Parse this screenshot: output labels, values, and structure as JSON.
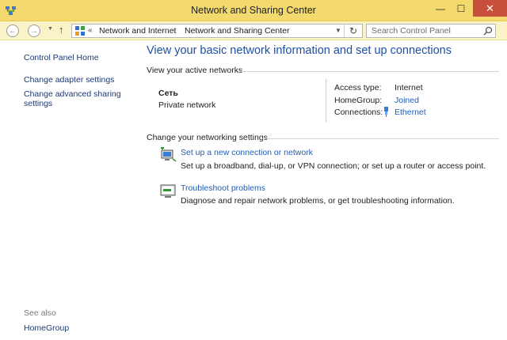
{
  "window": {
    "title": "Network and Sharing Center",
    "minimize_glyph": "—",
    "maximize_glyph": "☐",
    "close_glyph": "✕"
  },
  "nav": {
    "back_glyph": "←",
    "forward_glyph": "→",
    "dropdown_glyph": "▼",
    "up_glyph": "↑",
    "overflow_glyph": "«",
    "breadcrumb": [
      "Network and Internet",
      "Network and Sharing Center"
    ],
    "separator_glyph": "›",
    "refresh_glyph": "↻",
    "search_placeholder": "Search Control Panel"
  },
  "sidebar": {
    "home": "Control Panel Home",
    "links": [
      "Change adapter settings",
      "Change advanced sharing settings"
    ],
    "see_also_label": "See also",
    "see_also_links": [
      "HomeGroup"
    ]
  },
  "main": {
    "title": "View your basic network information and set up connections",
    "active_networks": {
      "header": "View your active networks",
      "network_name": "Сеть",
      "network_type": "Private network",
      "access_type_label": "Access type:",
      "access_type_value": "Internet",
      "homegroup_label": "HomeGroup:",
      "homegroup_value": "Joined",
      "connections_label": "Connections:",
      "connections_value": "Ethernet"
    },
    "change_settings": {
      "header": "Change your networking settings",
      "tasks": [
        {
          "title": "Set up a new connection or network",
          "description": "Set up a broadband, dial-up, or VPN connection; or set up a router or access point.",
          "icon": "new-connection-icon"
        },
        {
          "title": "Troubleshoot problems",
          "description": "Diagnose and repair network problems, or get troubleshooting information.",
          "icon": "troubleshoot-icon"
        }
      ]
    }
  },
  "colors": {
    "titlebar": "#f3d96e",
    "navbar": "#fbf3c8",
    "close_button": "#c7503b",
    "link": "#1e5cb3",
    "title_blue": "#1e4fa3"
  }
}
